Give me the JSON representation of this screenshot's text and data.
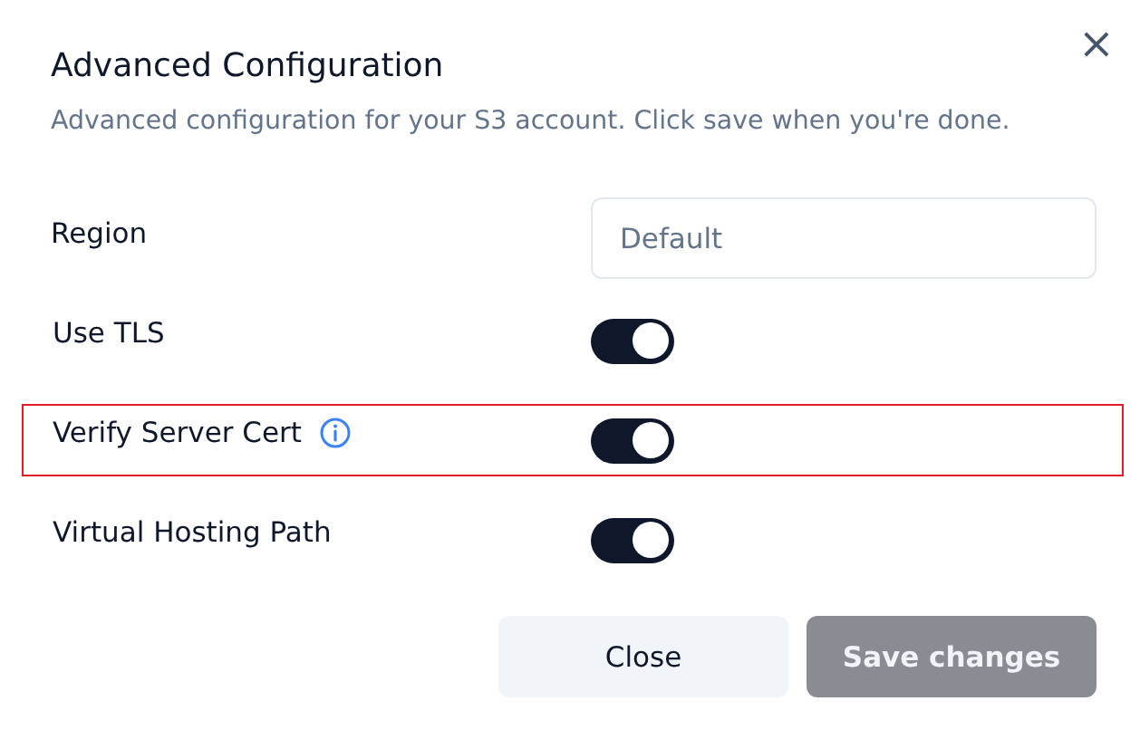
{
  "dialog": {
    "title": "Advanced Configuration",
    "description": "Advanced configuration for your S3 account. Click save when you're done.",
    "close_icon": "×"
  },
  "region": {
    "label": "Region",
    "placeholder": "Default"
  },
  "toggles": [
    {
      "label": "Use TLS",
      "on": true,
      "info": false,
      "highlighted": false
    },
    {
      "label": "Verify Server Cert",
      "on": true,
      "info": true,
      "highlighted": true
    },
    {
      "label": "Virtual Hosting Path",
      "on": true,
      "info": false,
      "highlighted": false
    }
  ],
  "buttons": [
    {
      "label": "Close",
      "kind": "secondary",
      "disabled": false
    },
    {
      "label": "Save changes",
      "kind": "primary",
      "disabled": true
    }
  ]
}
